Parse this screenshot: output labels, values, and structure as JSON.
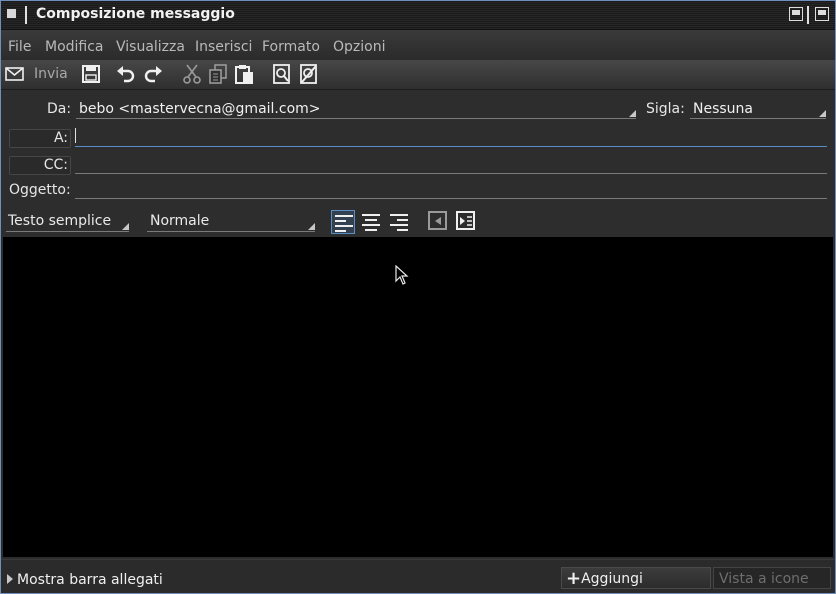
{
  "window": {
    "title": "Composizione messaggio"
  },
  "menu": [
    "File",
    "Modifica",
    "Visualizza",
    "Inserisci",
    "Formato",
    "Opzioni"
  ],
  "toolbar": {
    "send_label": "Invia"
  },
  "fields": {
    "from_label": "Da:",
    "from_value": "bebo <mastervecna@gmail.com>",
    "signature_label": "Sigla:",
    "signature_value": "Nessuna",
    "to_label": "A:",
    "to_value": "",
    "cc_label": "CC:",
    "cc_value": "",
    "subject_label": "Oggetto:",
    "subject_value": ""
  },
  "format": {
    "mode": "Testo semplice",
    "style": "Normale"
  },
  "status": {
    "show_attachments": "Mostra barra allegati",
    "add_attachment": "Aggiungi allegato...",
    "view_icons": "Vista a icone"
  }
}
